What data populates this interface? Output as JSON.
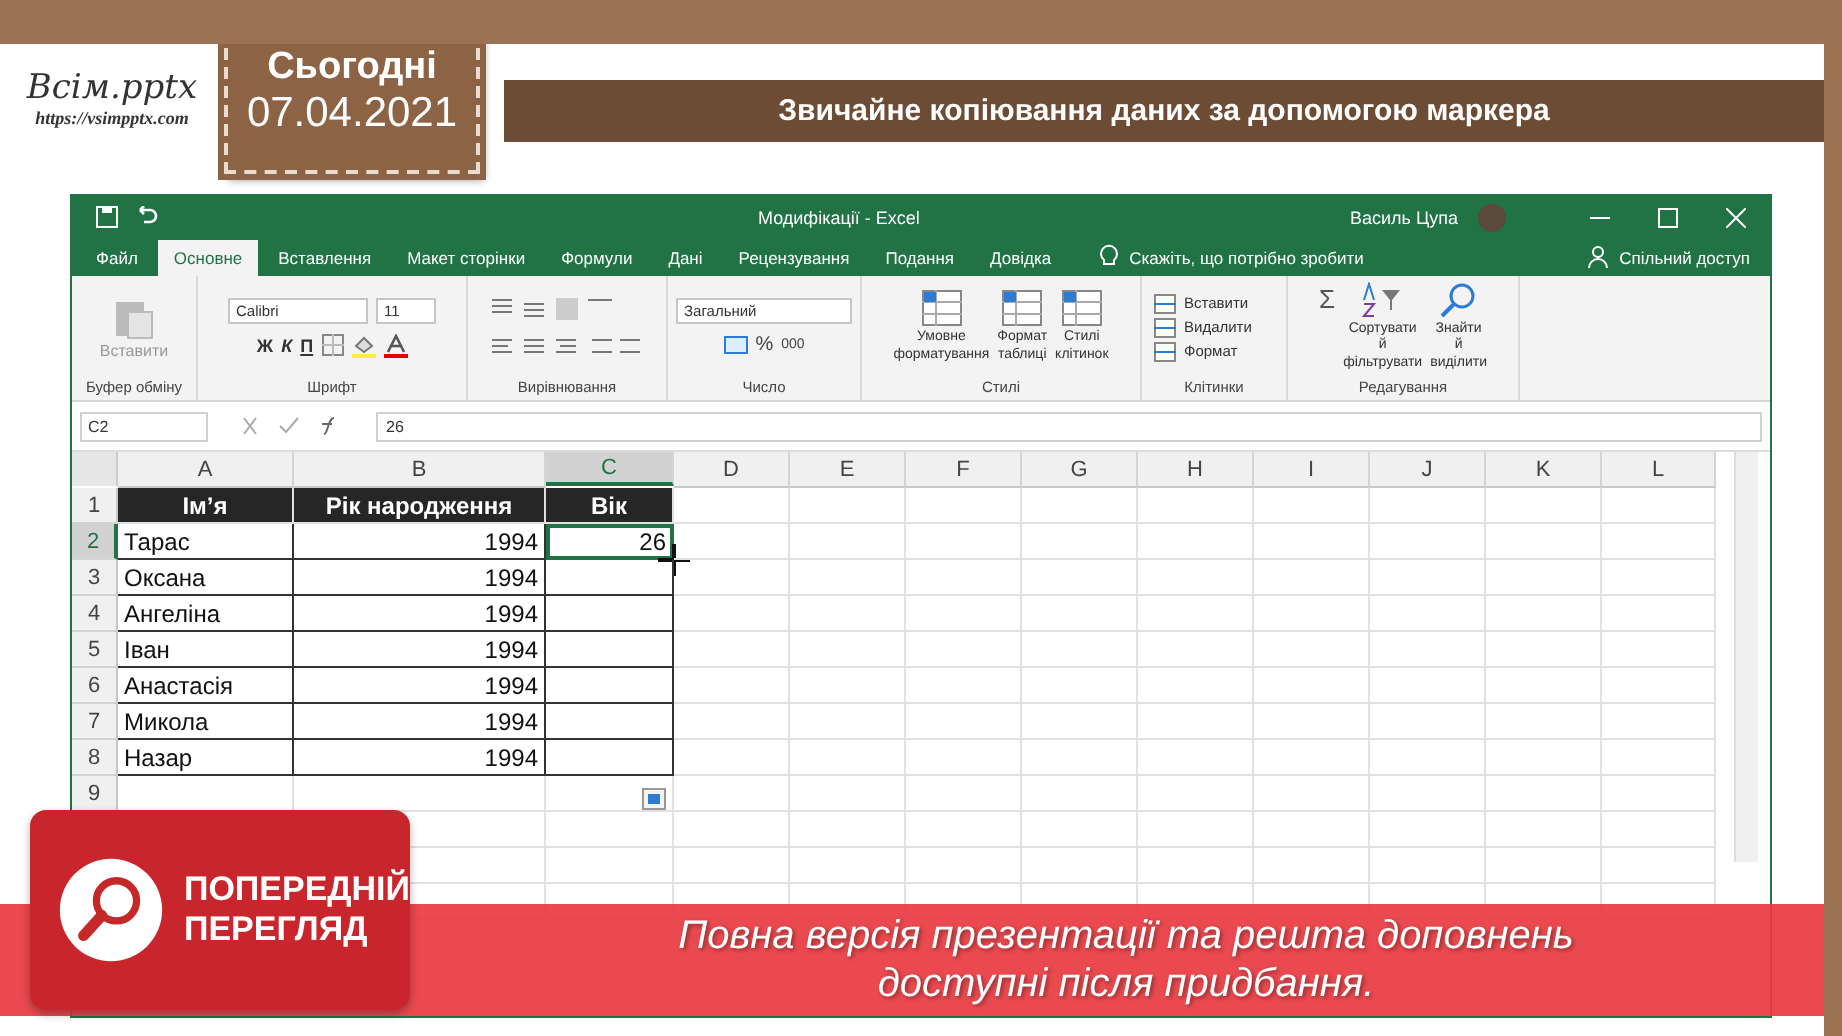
{
  "slide": {
    "logo": {
      "title": "Всім.pptx",
      "url": "https://vsimpptx.com"
    },
    "date_tag": {
      "label": "Сьогодні",
      "date": "07.04.2021"
    },
    "title": "Звичайне копіювання даних за допомогою маркера"
  },
  "excel": {
    "title": "Модифікації - Excel",
    "user": "Василь Цупа",
    "tell_me": "Скажіть, що потрібно зробити",
    "share": "Спільний доступ",
    "tabs": [
      {
        "label": "Файл",
        "selected": false
      },
      {
        "label": "Основне",
        "selected": true
      },
      {
        "label": "Вставлення",
        "selected": false
      },
      {
        "label": "Макет сторінки",
        "selected": false
      },
      {
        "label": "Формули",
        "selected": false
      },
      {
        "label": "Дані",
        "selected": false
      },
      {
        "label": "Рецензування",
        "selected": false
      },
      {
        "label": "Подання",
        "selected": false
      },
      {
        "label": "Довідка",
        "selected": false
      }
    ],
    "ribbon": {
      "clipboard": {
        "label": "Буфер обміну",
        "paste": "Вставити"
      },
      "font": {
        "label": "Шрифт",
        "name": "Calibri",
        "size": "11",
        "styles": [
          "Ж",
          "К",
          "П"
        ]
      },
      "alignment": {
        "label": "Вирівнювання"
      },
      "number": {
        "label": "Число",
        "format": "Загальний",
        "percent": "%",
        "thousands": "000"
      },
      "styles": {
        "label": "Стилі",
        "buttons": [
          "Умовне форматування",
          "Формат таблиці",
          "Стилі клітинок"
        ]
      },
      "cells": {
        "label": "Клітинки",
        "buttons": [
          "Вставити",
          "Видалити",
          "Формат"
        ]
      },
      "editing": {
        "label": "Редагування",
        "autosum": "Σ",
        "buttons": [
          "Сортувати й фільтрувати",
          "Знайти й виділити"
        ]
      }
    },
    "name_box": "C2",
    "formula": "26",
    "columns": [
      {
        "label": "A",
        "selected": false
      },
      {
        "label": "B",
        "selected": false
      },
      {
        "label": "C",
        "selected": true
      },
      {
        "label": "D",
        "selected": false
      },
      {
        "label": "E",
        "selected": false
      },
      {
        "label": "F",
        "selected": false
      },
      {
        "label": "G",
        "selected": false
      },
      {
        "label": "H",
        "selected": false
      },
      {
        "label": "I",
        "selected": false
      },
      {
        "label": "J",
        "selected": false
      },
      {
        "label": "K",
        "selected": false
      },
      {
        "label": "L",
        "selected": false
      }
    ],
    "rows": [
      {
        "number": "1",
        "kind": "header",
        "selected": false,
        "cells": [
          "Ім’я",
          "Рік народження",
          "Вік"
        ]
      },
      {
        "number": "2",
        "kind": "data",
        "selected": true,
        "cells": [
          "Тарас",
          "1994",
          "26"
        ]
      },
      {
        "number": "3",
        "kind": "data",
        "selected": false,
        "cells": [
          "Оксана",
          "1994"
        ]
      },
      {
        "number": "4",
        "kind": "data",
        "selected": false,
        "cells": [
          "Ангеліна",
          "1994"
        ]
      },
      {
        "number": "5",
        "kind": "data",
        "selected": false,
        "cells": [
          "Іван",
          "1994"
        ]
      },
      {
        "number": "6",
        "kind": "data",
        "selected": false,
        "cells": [
          "Анастасія",
          "1994"
        ]
      },
      {
        "number": "7",
        "kind": "data",
        "selected": false,
        "cells": [
          "Микола",
          "1994"
        ]
      },
      {
        "number": "8",
        "kind": "data",
        "selected": false,
        "cells": [
          "Назар",
          "1994"
        ]
      },
      {
        "number": "9",
        "kind": "empty",
        "selected": false,
        "cells": []
      }
    ]
  },
  "banner": {
    "badge_lines": [
      "ПОПЕРЕДНІЙ",
      "ПЕРЕГЛЯД"
    ],
    "text_lines": [
      "Повна версія презентації та решта доповнень",
      "доступні після придбання."
    ]
  }
}
